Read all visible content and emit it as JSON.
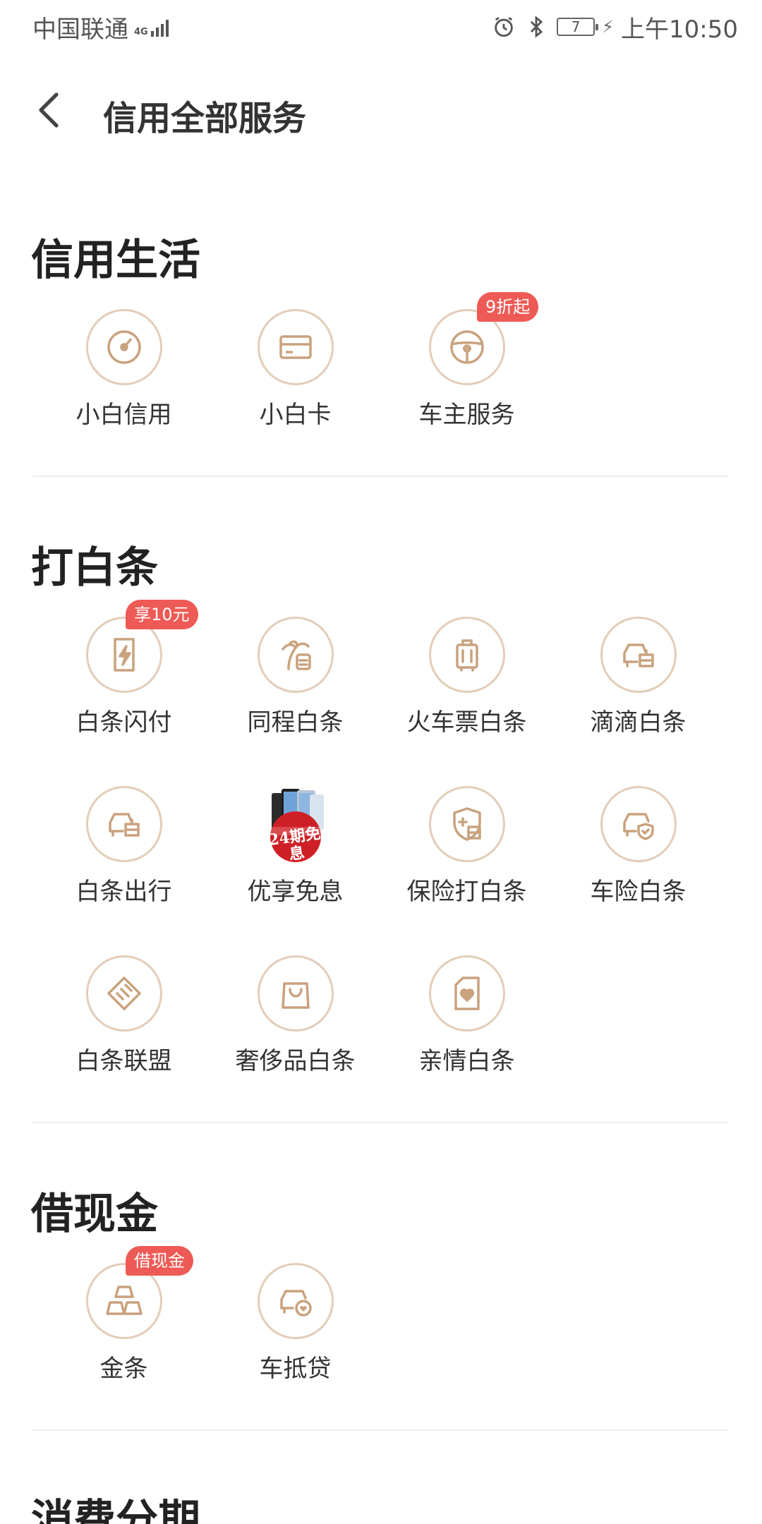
{
  "status_bar": {
    "carrier": "中国联通",
    "network": "4G",
    "battery": "7",
    "time": "上午10:50"
  },
  "header": {
    "title": "信用全部服务"
  },
  "sections": [
    {
      "title": "信用生活",
      "items": [
        {
          "label": "小白信用",
          "icon": "gauge-icon"
        },
        {
          "label": "小白卡",
          "icon": "card-icon"
        },
        {
          "label": "车主服务",
          "icon": "steering-wheel-icon",
          "badge": "9折起"
        }
      ]
    },
    {
      "title": "打白条",
      "items": [
        {
          "label": "白条闪付",
          "icon": "flash-pay-icon",
          "badge": "享10元"
        },
        {
          "label": "同程白条",
          "icon": "coconut-tree-icon"
        },
        {
          "label": "火车票白条",
          "icon": "luggage-icon"
        },
        {
          "label": "滴滴白条",
          "icon": "car-icon"
        },
        {
          "label": "白条出行",
          "icon": "car-icon"
        },
        {
          "label": "优享免息",
          "icon": "phone-promo-image",
          "promo_text": "24期免息"
        },
        {
          "label": "保险打白条",
          "icon": "insurance-shield-icon"
        },
        {
          "label": "车险白条",
          "icon": "car-shield-icon"
        },
        {
          "label": "白条联盟",
          "icon": "handshake-icon"
        },
        {
          "label": "奢侈品白条",
          "icon": "shopping-bag-icon"
        },
        {
          "label": "亲情白条",
          "icon": "heart-card-icon"
        }
      ]
    },
    {
      "title": "借现金",
      "items": [
        {
          "label": "金条",
          "icon": "gold-bars-icon",
          "badge": "借现金"
        },
        {
          "label": "车抵贷",
          "icon": "car-heart-icon"
        }
      ]
    },
    {
      "title": "消费分期",
      "items": []
    }
  ],
  "colors": {
    "accent": "#c9a27e",
    "badge": "#ee5a55",
    "divider": "#eeeeee"
  }
}
